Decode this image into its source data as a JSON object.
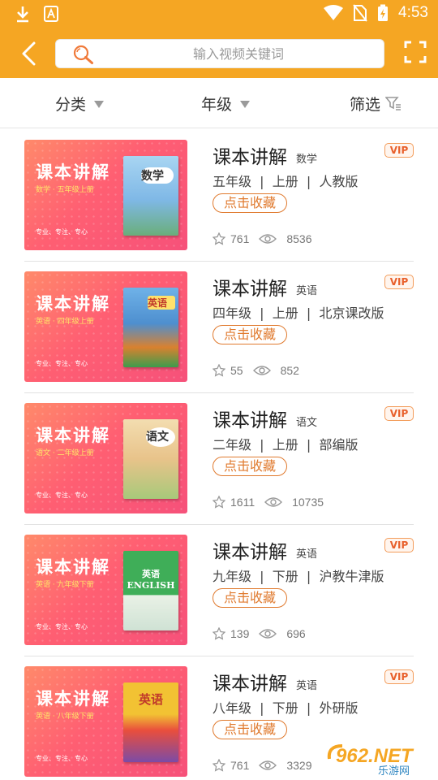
{
  "status_bar": {
    "time": "4:53"
  },
  "header": {
    "search_placeholder": "输入视频关键词"
  },
  "filters": [
    {
      "label": "分类"
    },
    {
      "label": "年级"
    },
    {
      "label": "筛选"
    }
  ],
  "items": [
    {
      "title": "课本讲解",
      "subject": "数学",
      "badge": "VIP",
      "meta": "五年级  |  上册  |  人教版",
      "collect_label": "点击收藏",
      "stars": "761",
      "views": "8536",
      "thumb": {
        "title": "课本讲解",
        "subtitle": "数学 · 五年级上册",
        "footer": "专业、专注、专心",
        "book_label": "数学",
        "book_color": "#7FB8E6"
      }
    },
    {
      "title": "课本讲解",
      "subject": "英语",
      "badge": "VIP",
      "meta": "四年级  |  上册  |  北京课改版",
      "collect_label": "点击收藏",
      "stars": "55",
      "views": "852",
      "thumb": {
        "title": "课本讲解",
        "subtitle": "英语 · 四年级上册",
        "footer": "专业、专注、专心",
        "book_label": "英语",
        "book_color": "#5A9AD6"
      }
    },
    {
      "title": "课本讲解",
      "subject": "语文",
      "badge": "VIP",
      "meta": "二年级  |  上册  |  部编版",
      "collect_label": "点击收藏",
      "stars": "1611",
      "views": "10735",
      "thumb": {
        "title": "课本讲解",
        "subtitle": "语文 · 二年级上册",
        "footer": "专业、专注、专心",
        "book_label": "语文",
        "book_color": "#E8C38A"
      }
    },
    {
      "title": "课本讲解",
      "subject": "英语",
      "badge": "VIP",
      "meta": "九年级  |  下册  |  沪教牛津版",
      "collect_label": "点击收藏",
      "stars": "139",
      "views": "696",
      "thumb": {
        "title": "课本讲解",
        "subtitle": "英语 · 九年级下册",
        "footer": "专业、专注、专心",
        "book_label": "英语 ENGLISH",
        "book_color": "#3FAE58"
      }
    },
    {
      "title": "课本讲解",
      "subject": "英语",
      "badge": "VIP",
      "meta": "八年级  |  下册  |  外研版",
      "collect_label": "点击收藏",
      "stars": "761",
      "views": "3329",
      "thumb": {
        "title": "课本讲解",
        "subtitle": "英语 · 八年级下册",
        "footer": "专业、专注、专心",
        "book_label": "英语",
        "book_color": "#F2C233"
      }
    }
  ],
  "watermark": {
    "text": "962.NET",
    "subtext": "乐游网"
  },
  "colors": {
    "accent": "#F5A623",
    "vip": "#E8602C",
    "collect": "#E07A2E",
    "thumb_gradient_a": "#FF8A6A",
    "thumb_gradient_b": "#F6517A"
  }
}
